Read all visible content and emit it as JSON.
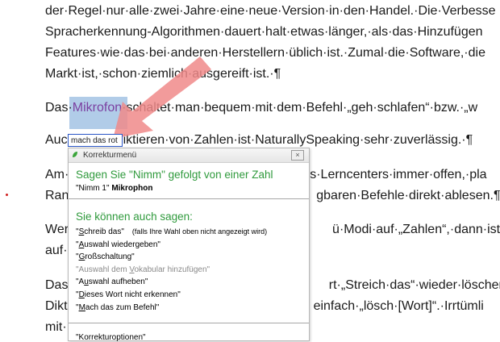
{
  "document": {
    "lines": [
      "der·Regel·nur·alle·zwei·Jahre·eine·neue·Version·in·den·Handel.·Die·Verbesse",
      "Spracherkennung-Algorithmen·dauert·halt·etwas·länger,·als·das·Hinzufügen",
      "Features·wie·das·bei·anderen·Herstellern·üblich·ist.·Zumal·die·Software,·die",
      "Markt·ist,·schon·ziemlich·ausgereift·ist.·¶",
      "",
      "Das·Mikrofon·schaltet·man·bequem·mit·dem·Befehl·„geh·schlafen“·bzw.·„w",
      "",
      "Auch·beim·Diktieren·von·Zahlen·ist·NaturallySpeaking·sehr·zuverlässig.·¶",
      "",
      "Am·es·Lerncenters·immer·offen,·pla",
      "Rand gbaren·Befehle·direkt·ablesen.¶",
      "",
      "Wer ü·Modi·auf·„Zahlen“,·dann·ist·di",
      "auf·Z",
      "",
      "Das· rt·„Streich·das“·wieder·löschen.",
      "Dikt einfach·„lösch·[Wort]“.·Irrtümli",
      "mit·"
    ],
    "mikrofon_prefix": "Das·",
    "mikrofon_word": "Mikrofon",
    "mikrofon_suffix": "·schaltet·man·bequem·mit·dem·Befehl·„geh·schlafen“·bzw.·„w",
    "line8_prefix": "Auc",
    "line8_suffix": "iktieren·von·Zahlen·ist·NaturallySpeaking·sehr·zuverlässig.·¶"
  },
  "inline_box": {
    "text": "mach das rot"
  },
  "menu": {
    "title": "Korrekturmenü",
    "close_glyph": "×",
    "say_heading": "Sagen Sie \"Nimm\" gefolgt von einer Zahl",
    "choice_prefix": "\"Nimm 1\"",
    "choice_word": "Mikrophon",
    "also_heading": "Sie können auch sagen:",
    "item1": {
      "pre": "\"",
      "u": "S",
      "post": "chreib das\"",
      "note": "(falls Ihre Wahl oben nicht angezeigt wird)"
    },
    "item2": {
      "pre": "\"",
      "u": "A",
      "post": "uswahl wiedergeben\""
    },
    "item3": {
      "pre": "\"",
      "u": "G",
      "post": "roßschaltung\""
    },
    "item4": {
      "pre": "\"Auswahl dem ",
      "u": "V",
      "post": "okabular hinzufügen\""
    },
    "item5": {
      "pre": "\"A",
      "u": "u",
      "post": "swahl aufheben\""
    },
    "item6": {
      "pre": "\"",
      "u": "D",
      "post": "ieses Wort nicht erkennen\""
    },
    "item7": {
      "pre": "\"",
      "u": "M",
      "post": "ach das zum Befehl\""
    },
    "footer": "\"Korrekturoptionen\""
  },
  "colors": {
    "accent_green": "#2f9a3c",
    "selection_blue": "#a9c7e6",
    "arrow_red": "#f08a8a",
    "mikrofon_purple": "#7b3fa0"
  }
}
